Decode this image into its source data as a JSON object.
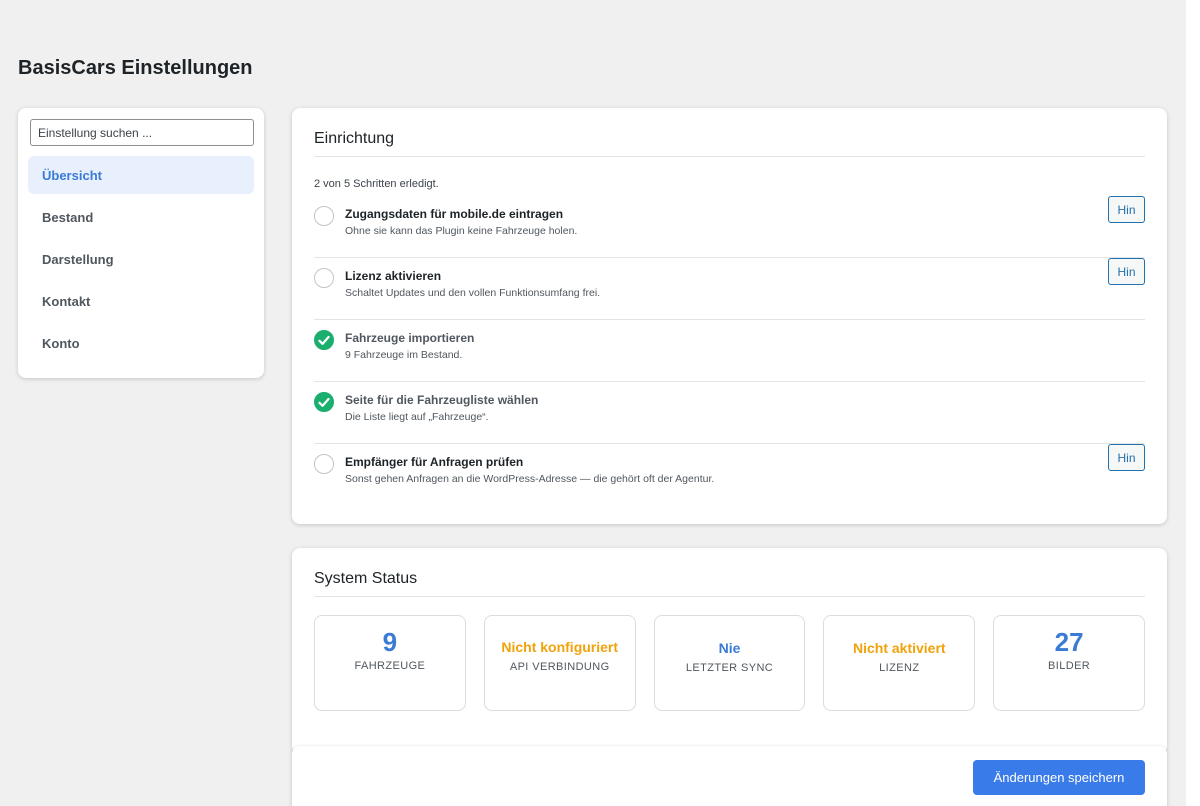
{
  "page": {
    "title": "BasisCars Einstellungen"
  },
  "sidebar": {
    "search_placeholder": "Einstellung suchen ...",
    "items": [
      {
        "label": "Übersicht",
        "active": true
      },
      {
        "label": "Bestand",
        "active": false
      },
      {
        "label": "Darstellung",
        "active": false
      },
      {
        "label": "Kontakt",
        "active": false
      },
      {
        "label": "Konto",
        "active": false
      }
    ]
  },
  "setup": {
    "title": "Einrichtung",
    "progress": "2 von 5 Schritten erledigt.",
    "steps": [
      {
        "title": "Zugangsdaten für mobile.de eintragen",
        "desc": "Ohne sie kann das Plugin keine Fahrzeuge holen.",
        "done": false,
        "button": "Hin"
      },
      {
        "title": "Lizenz aktivieren",
        "desc": "Schaltet Updates und den vollen Funktionsumfang frei.",
        "done": false,
        "button": "Hin"
      },
      {
        "title": "Fahrzeuge importieren",
        "desc": "9 Fahrzeuge im Bestand.",
        "done": true
      },
      {
        "title": "Seite für die Fahrzeugliste wählen",
        "desc": "Die Liste liegt auf „Fahrzeuge“.",
        "done": true
      },
      {
        "title": "Empfänger für Anfragen prüfen",
        "desc": "Sonst gehen Anfragen an die WordPress-Adresse — die gehört oft der Agentur.",
        "done": false,
        "button": "Hin"
      }
    ]
  },
  "status": {
    "title": "System Status",
    "tiles": [
      {
        "value": "9",
        "label": "FAHRZEUGE",
        "color": "#3a7bd5"
      },
      {
        "value": "Nicht konfiguriert",
        "label": "API VERBINDUNG",
        "color": "#f0a20a"
      },
      {
        "value": "Nie",
        "label": "LETZTER SYNC",
        "color": "#3a7bd5"
      },
      {
        "value": "Nicht aktiviert",
        "label": "LIZENZ",
        "color": "#f0a20a"
      },
      {
        "value": "27",
        "label": "BILDER",
        "color": "#3a7bd5"
      }
    ]
  },
  "footer": {
    "save_label": "Änderungen speichern"
  },
  "colors": {
    "accent": "#3a7bd5",
    "warning": "#f0a20a",
    "success": "#1aae6f",
    "link": "#2271b1"
  }
}
